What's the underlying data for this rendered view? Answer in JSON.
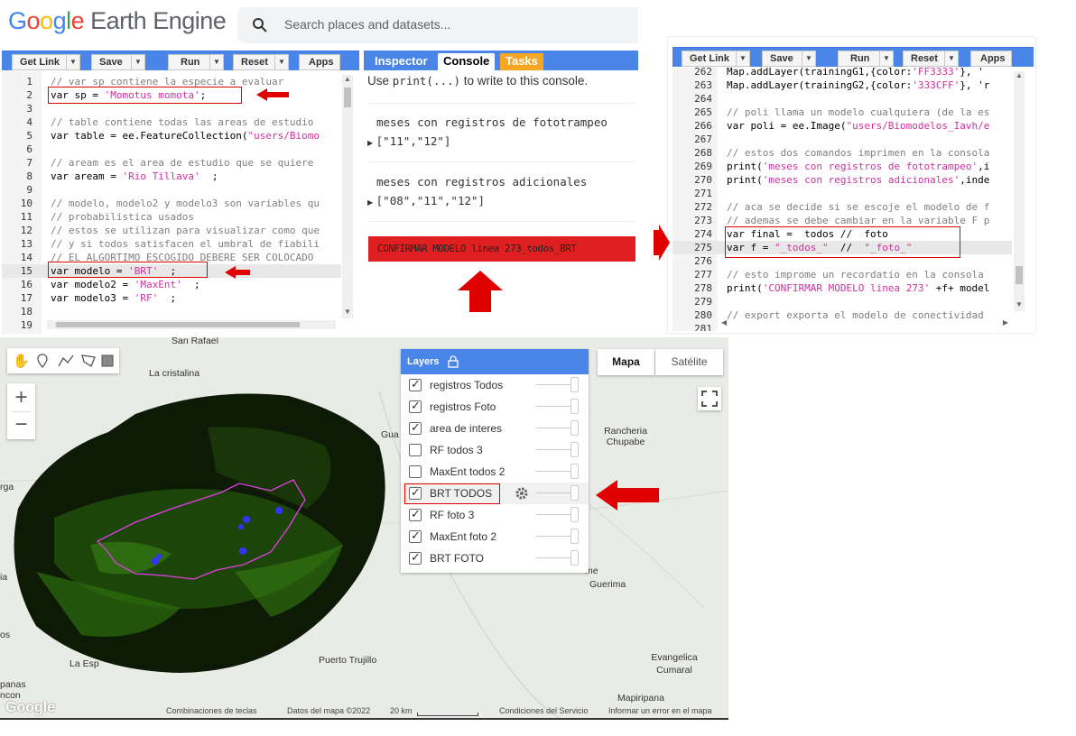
{
  "header": {
    "logo_google": [
      "G",
      "o",
      "o",
      "g",
      "l",
      "e"
    ],
    "logo_product": "Earth Engine",
    "search_placeholder": "Search places and datasets..."
  },
  "left_toolbar": {
    "buttons": [
      "Get Link",
      "Save",
      "Run",
      "Reset",
      "Apps"
    ]
  },
  "right_toolbar": {
    "buttons": [
      "Get Link",
      "Save",
      "Run",
      "Reset",
      "Apps"
    ]
  },
  "left_editor": {
    "lines": [
      {
        "n": "1",
        "text": "// var sp contiene la especie a evaluar"
      },
      {
        "n": "2",
        "pre": "var sp = ",
        "str": "'Momotus momota'",
        "post": ";"
      },
      {
        "n": "3",
        "text": ""
      },
      {
        "n": "4",
        "text": "// table contiene todas las areas de estudio"
      },
      {
        "n": "5",
        "pre": "var table = ee.FeatureCollection(",
        "str": "\"users/Biomo",
        "post": ""
      },
      {
        "n": "6",
        "text": ""
      },
      {
        "n": "7",
        "text": "// aream es el area de estudio que se quiere"
      },
      {
        "n": "8",
        "pre": "var aream = ",
        "str": "'Rio Tillava'",
        "post": "  ;"
      },
      {
        "n": "9",
        "text": ""
      },
      {
        "n": "10",
        "text": "// modelo, modelo2 y modelo3 son variables qu"
      },
      {
        "n": "11",
        "text": "// probabilistica usados"
      },
      {
        "n": "12",
        "text": "// estos se utilizan para visualizar como que"
      },
      {
        "n": "13",
        "text": "// y si todos satisfacen el umbral de fiabili"
      },
      {
        "n": "14",
        "text": "// EL ALGORTIMO ESCOGIDO DEBERE SER COLOCADO"
      },
      {
        "n": "15",
        "pre": "var modelo = ",
        "str": "'BRT'",
        "post": "  ;"
      },
      {
        "n": "16",
        "pre": "var modelo2 = ",
        "str": "'MaxEnt'",
        "post": "  ;"
      },
      {
        "n": "17",
        "pre": "var modelo3 = ",
        "str": "'RF'",
        "post": "  ;"
      },
      {
        "n": "18",
        "text": ""
      },
      {
        "n": "19",
        "text": ""
      }
    ]
  },
  "console": {
    "tabs": [
      "Inspector",
      "Console",
      "Tasks"
    ],
    "hint_pre": "Use ",
    "hint_code": "print(...)",
    "hint_post": " to write to this console.",
    "entries": [
      {
        "label": "meses con registros de fototrampeo",
        "value": "[\"11\",\"12\"]"
      },
      {
        "label": "meses con registros adicionales",
        "value": "[\"08\",\"11\",\"12\"]"
      }
    ],
    "banner": "CONFIRMAR MODELO linea 273_todos_BRT"
  },
  "right_editor": {
    "lines": [
      {
        "n": "262",
        "pre": "Map.addLayer(trainingG1,{color:",
        "str": "'FF3333'",
        "post": "}, '"
      },
      {
        "n": "263",
        "pre": "Map.addLayer(trainingG2,{color:",
        "str": "'333CFF'",
        "post": "}, 'r"
      },
      {
        "n": "264",
        "text": ""
      },
      {
        "n": "265",
        "text": "// poli llama un modelo cualquiera (de la es"
      },
      {
        "n": "266",
        "pre": "var poli = ee.Image(",
        "str": "\"users/Biomodelos_Iavh/e",
        "post": ""
      },
      {
        "n": "267",
        "text": ""
      },
      {
        "n": "268",
        "text": "// estos dos comandos imprimen en la consola"
      },
      {
        "n": "269",
        "pre": "print(",
        "str": "'meses con registros de fototrampeo'",
        "post": ",i"
      },
      {
        "n": "270",
        "pre": "print(",
        "str": "'meses con registros adicionales'",
        "post": ",inde"
      },
      {
        "n": "271",
        "text": ""
      },
      {
        "n": "272",
        "text": "// aca se decide si se escoje el modelo de f"
      },
      {
        "n": "273",
        "text": "// ademas se debe cambiar en la variable F p"
      },
      {
        "n": "274",
        "pre": "var final =  todos //  foto",
        "str": "",
        "post": ""
      },
      {
        "n": "275",
        "pre": "var f = ",
        "str": "\"_todos_\"",
        "post": "  //  ",
        "str2": "\"_foto_\""
      },
      {
        "n": "276",
        "text": ""
      },
      {
        "n": "277",
        "text": "// esto improme un recordatio en la consola"
      },
      {
        "n": "278",
        "pre": "print(",
        "str": "'CONFIRMAR MODELO linea 273'",
        "post": " +f+ model"
      },
      {
        "n": "279",
        "text": ""
      },
      {
        "n": "280",
        "text": "// export exporta el modelo de conectividad"
      },
      {
        "n": "281",
        "text": ""
      }
    ]
  },
  "map": {
    "place_labels": [
      "San Rafael",
      "La cristalina",
      "Gua",
      "Rancheria Chupabe",
      "rga",
      "Guerima",
      "Puerto Trujillo",
      "Evangelica Cumaral",
      "Mapiripana",
      "La Esp",
      "panas",
      "ncon",
      "ia",
      "os",
      "me"
    ],
    "map_type_buttons": [
      "Mapa",
      "Satélite"
    ],
    "layers_title": "Layers",
    "layers": [
      {
        "name": "registros Todos",
        "checked": true
      },
      {
        "name": "registros Foto",
        "checked": true
      },
      {
        "name": "area de interes",
        "checked": true
      },
      {
        "name": "RF todos 3",
        "checked": false
      },
      {
        "name": "MaxEnt todos 2",
        "checked": false
      },
      {
        "name": "BRT TODOS",
        "checked": true
      },
      {
        "name": "RF foto 3",
        "checked": true
      },
      {
        "name": "MaxEnt foto 2",
        "checked": true
      },
      {
        "name": "BRT FOTO",
        "checked": true
      }
    ],
    "footer": {
      "google": "Google",
      "shortcuts": "Combinaciones de teclas",
      "data": "Datos del mapa ©2022",
      "scale": "20 km",
      "terms": "Condiciones del Servicio",
      "report": "Informar un error en el mapa"
    }
  },
  "colors": {
    "toolbar_blue": "#4a86e8",
    "tasks_orange": "#f6a623",
    "annotation_red": "#e00000",
    "banner_red": "#e02020",
    "area_outline": "#e040e0",
    "points_blue": "#3333ff"
  }
}
